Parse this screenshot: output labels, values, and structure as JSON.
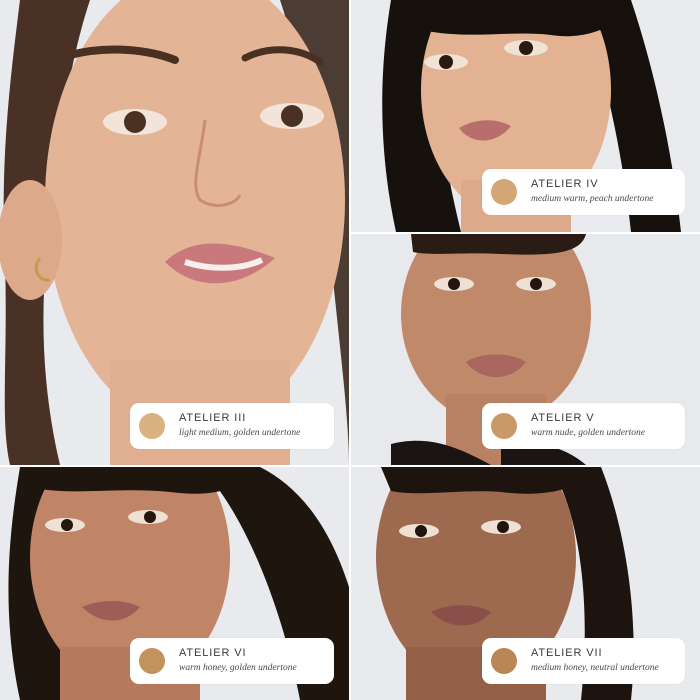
{
  "shades": [
    {
      "name": "ATELIER III",
      "description": "light medium, golden undertone",
      "swatch_color": "#d8b27f"
    },
    {
      "name": "ATELIER IV",
      "description": "medium warm, peach undertone",
      "swatch_color": "#d4a676"
    },
    {
      "name": "ATELIER V",
      "description": "warm nude, golden undertone",
      "swatch_color": "#c99a66"
    },
    {
      "name": "ATELIER VI",
      "description": "warm honey, golden undertone",
      "swatch_color": "#c3935e"
    },
    {
      "name": "ATELIER VII",
      "description": "medium honey, neutral undertone",
      "swatch_color": "#b98754"
    }
  ],
  "colors": {
    "background": "#e5e7ea",
    "card": "#ffffff"
  }
}
